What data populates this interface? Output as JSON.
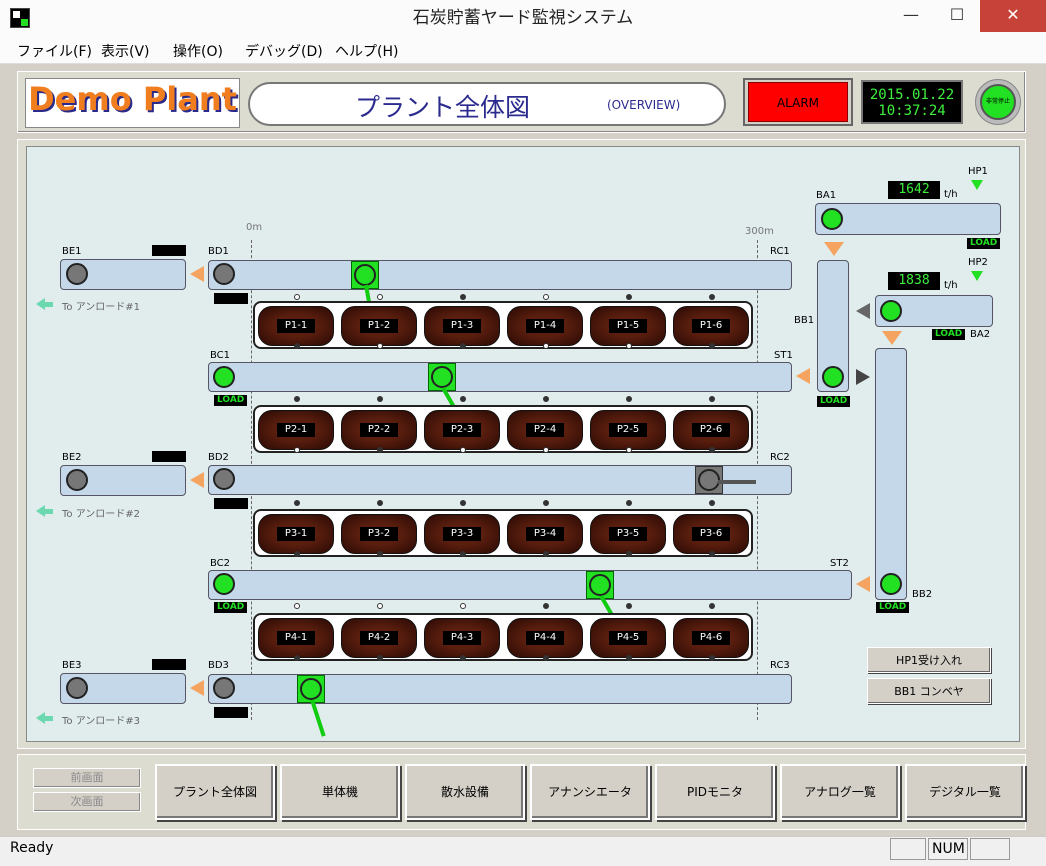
{
  "window": {
    "title": "石炭貯蓄ヤード監視システム",
    "minimize": "—",
    "maximize": "☐",
    "close": "✕"
  },
  "menu": [
    {
      "label": "ファイル(F)"
    },
    {
      "label": "表示(V)"
    },
    {
      "label": "操作(O)"
    },
    {
      "label": "デバッグ(D)"
    },
    {
      "label": "ヘルプ(H)"
    }
  ],
  "header": {
    "logo": "Demo Plant",
    "title": "プラント全体図",
    "subtitle": "(OVERVIEW)",
    "alarm": "ALARM",
    "date": "2015.01.22",
    "time": "10:37:24",
    "estop": "非常停止"
  },
  "scale": {
    "start": "0m",
    "end": "300m"
  },
  "conveyors": {
    "BE1": "BE1",
    "BE2": "BE2",
    "BE3": "BE3",
    "BD1": "BD1",
    "BD2": "BD2",
    "BD3": "BD3",
    "BC1": "BC1",
    "BC2": "BC2",
    "RC1": "RC1",
    "RC2": "RC2",
    "RC3": "RC3",
    "ST1": "ST1",
    "ST2": "ST2",
    "BA1": "BA1",
    "BA2": "BA2",
    "BB1": "BB1",
    "BB2": "BB2",
    "HP1": "HP1",
    "HP2": "HP2"
  },
  "load": "LOAD",
  "to_unload": [
    "To アンロード#1",
    "To アンロード#2",
    "To アンロード#3"
  ],
  "flow": {
    "BA1_tph": "1642",
    "BA2_tph": "1838",
    "unit": "t/h"
  },
  "piles": [
    [
      "P1-1",
      "P1-2",
      "P1-3",
      "P1-4",
      "P1-5",
      "P1-6"
    ],
    [
      "P2-1",
      "P2-2",
      "P2-3",
      "P2-4",
      "P2-5",
      "P2-6"
    ],
    [
      "P3-1",
      "P3-2",
      "P3-3",
      "P3-4",
      "P3-5",
      "P3-6"
    ],
    [
      "P4-1",
      "P4-2",
      "P4-3",
      "P4-4",
      "P4-5",
      "P4-6"
    ]
  ],
  "side_buttons": {
    "hp1": "HP1受け入れ",
    "bb1": "BB1 コンベヤ"
  },
  "nav": {
    "prev": "前画面",
    "next": "次画面",
    "buttons": [
      "プラント全体図",
      "単体機",
      "散水設備",
      "アナンシエータ",
      "PIDモニタ",
      "アナログ一覧",
      "デジタル一覧"
    ]
  },
  "status": {
    "text": "Ready",
    "num": "NUM"
  },
  "colors": {
    "running": "#22e022",
    "stopped": "#777777",
    "alarm": "#ff0000",
    "conveyor": "#c4d8ea",
    "logo": "#f07d1e"
  }
}
